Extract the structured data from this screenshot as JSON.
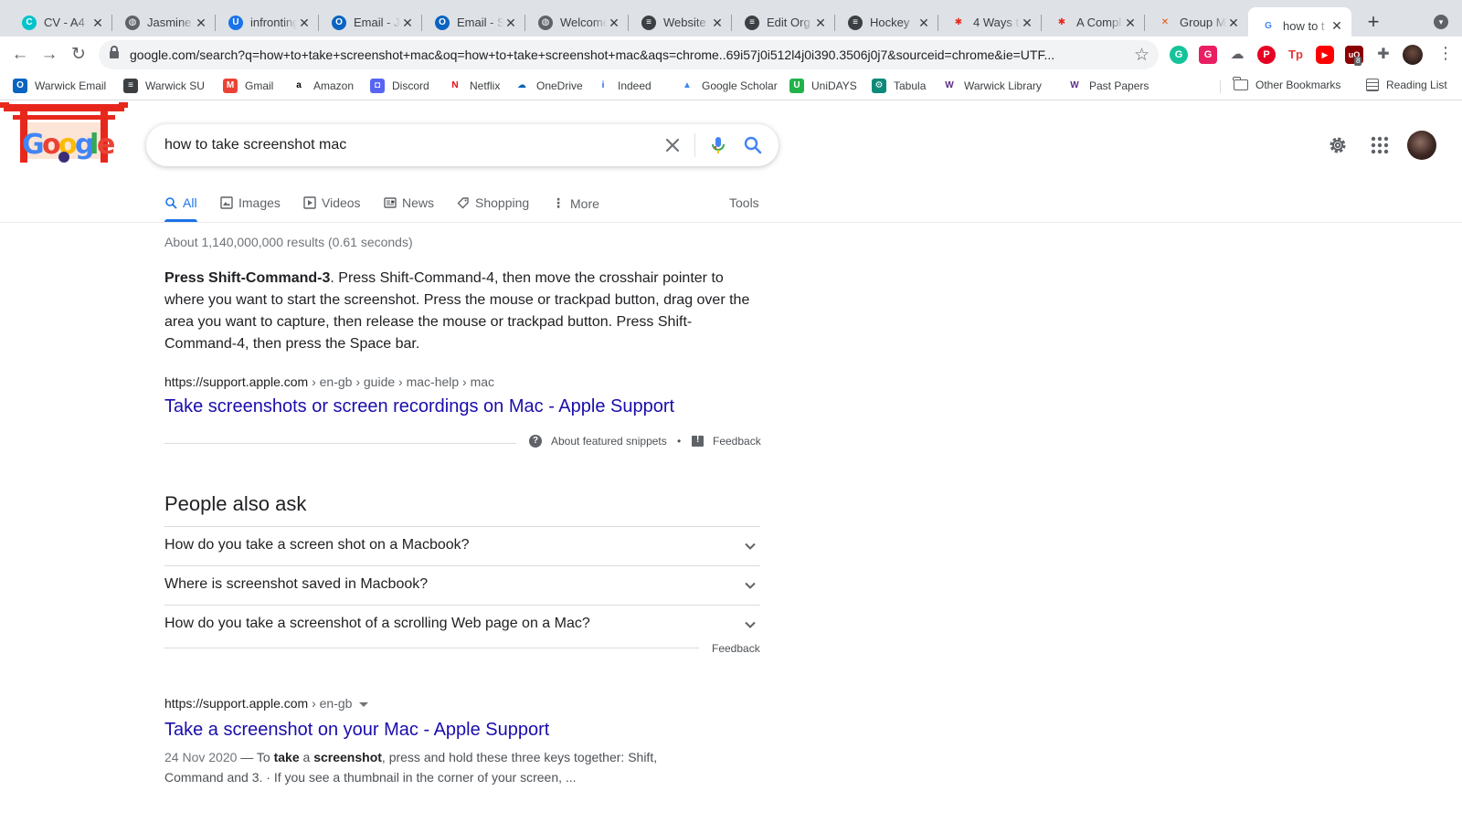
{
  "browser": {
    "tabs": [
      {
        "title": "CV - A4",
        "icon": "canva-icon",
        "color": "#00c4cc",
        "glyph": "C"
      },
      {
        "title": "Jasmine",
        "icon": "globe-icon",
        "color": "#5f6368",
        "glyph": "◍"
      },
      {
        "title": "infronting",
        "icon": "bookmark-u-icon",
        "color": "#1a73e8",
        "glyph": "U"
      },
      {
        "title": "Email - J",
        "icon": "outlook-icon",
        "color": "#0a64c2",
        "glyph": "O"
      },
      {
        "title": "Email - S",
        "icon": "outlook-icon",
        "color": "#0a64c2",
        "glyph": "O"
      },
      {
        "title": "Welcome",
        "icon": "globe-icon",
        "color": "#5f6368",
        "glyph": "◍"
      },
      {
        "title": "Website",
        "icon": "warwick-su-icon",
        "color": "#3c4043",
        "glyph": "≡"
      },
      {
        "title": "Edit Org",
        "icon": "warwick-su-icon",
        "color": "#3c4043",
        "glyph": "≡"
      },
      {
        "title": "Hockey",
        "icon": "warwick-su-icon",
        "color": "#3c4043",
        "glyph": "≡"
      },
      {
        "title": "4 Ways t",
        "icon": "asterisk-icon",
        "color": "#ffffff",
        "glyph": "✱"
      },
      {
        "title": "A Compl",
        "icon": "asterisk-icon",
        "color": "#ffffff",
        "glyph": "✱"
      },
      {
        "title": "Group M",
        "icon": "x-logo-icon",
        "color": "#ffffff",
        "glyph": "✕"
      },
      {
        "title": "how to t",
        "icon": "google-g-icon",
        "color": "#ffffff",
        "glyph": "G"
      }
    ],
    "active_tab_index": 12,
    "new_tab_glyph": "+",
    "url": "google.com/search?q=how+to+take+screenshot+mac&oq=how+to+take+screenshot+mac&aqs=chrome..69i57j0i512l4j0i390.3506j0j7&sourceid=chrome&ie=UTF...",
    "extension_badge": "8",
    "bookmarks": [
      {
        "label": "Warwick Email",
        "icon": "outlook-icon",
        "color": "#0a64c2",
        "glyph": "O"
      },
      {
        "label": "Warwick SU",
        "icon": "warwick-su-icon",
        "color": "#3c4043",
        "glyph": "≡"
      },
      {
        "label": "Gmail",
        "icon": "gmail-icon",
        "color": "#ea4335",
        "glyph": "M"
      },
      {
        "label": "Amazon",
        "icon": "amazon-icon",
        "color": "#ffffff",
        "glyph": "a"
      },
      {
        "label": "Discord",
        "icon": "discord-icon",
        "color": "#5865f2",
        "glyph": "◘"
      },
      {
        "label": "Netflix",
        "icon": "netflix-icon",
        "color": "#ffffff",
        "glyph": "N"
      },
      {
        "label": "OneDrive",
        "icon": "onedrive-icon",
        "color": "#ffffff",
        "glyph": "☁"
      },
      {
        "label": "Indeed",
        "icon": "indeed-icon",
        "color": "#ffffff",
        "glyph": "i"
      },
      {
        "label": "Google Scholar",
        "icon": "scholar-icon",
        "color": "#ffffff",
        "glyph": "▲"
      },
      {
        "label": "UniDAYS",
        "icon": "unidays-icon",
        "color": "#21b24b",
        "glyph": "U"
      },
      {
        "label": "Tabula",
        "icon": "tabula-icon",
        "color": "#0d8a7a",
        "glyph": "⚙"
      },
      {
        "label": "Warwick Library",
        "icon": "warwick-w-icon",
        "color": "#ffffff",
        "glyph": "W"
      },
      {
        "label": "Past Papers",
        "icon": "warwick-w-icon",
        "color": "#ffffff",
        "glyph": "W"
      }
    ],
    "other_bookmarks": "Other Bookmarks",
    "reading_list": "Reading List"
  },
  "search": {
    "query": "how to take screenshot mac",
    "tabs": [
      "All",
      "Images",
      "Videos",
      "News",
      "Shopping",
      "More"
    ],
    "tools": "Tools",
    "stats": "About 1,140,000,000 results (0.61 seconds)"
  },
  "featured_snippet": {
    "bold": "Press Shift-Command-3",
    "text": ". Press Shift-Command-4, then move the crosshair pointer to where you want to start the screenshot. Press the mouse or trackpad button, drag over the area you want to capture, then release the mouse or trackpad button. Press Shift-Command-4, then press the Space bar.",
    "cite_host": "https://support.apple.com",
    "cite_path": " › en-gb › guide › mac-help › mac",
    "title": "Take screenshots or screen recordings on Mac - Apple Support",
    "about": "About featured snippets",
    "dot": "•",
    "feedback": "Feedback"
  },
  "people_also_ask": {
    "title": "People also ask",
    "questions": [
      "How do you take a screen shot on a Macbook?",
      "Where is screenshot saved in Macbook?",
      "How do you take a screenshot of a scrolling Web page on a Mac?"
    ],
    "feedback": "Feedback"
  },
  "result2": {
    "cite_host": "https://support.apple.com",
    "cite_path": " › en-gb",
    "title": "Take a screenshot on your Mac - Apple Support",
    "date": "24 Nov 2020",
    "desc_1": " — To ",
    "desc_b1": "take",
    "desc_2": " a ",
    "desc_b2": "screenshot",
    "desc_3": ", press and hold these three keys together: Shift, Command and 3. · If you see a thumbnail in the corner of your screen, ..."
  },
  "colors": {
    "link": "#1a0dab",
    "accent": "#1a73e8",
    "tabstrip_bg": "#dee1e6"
  }
}
